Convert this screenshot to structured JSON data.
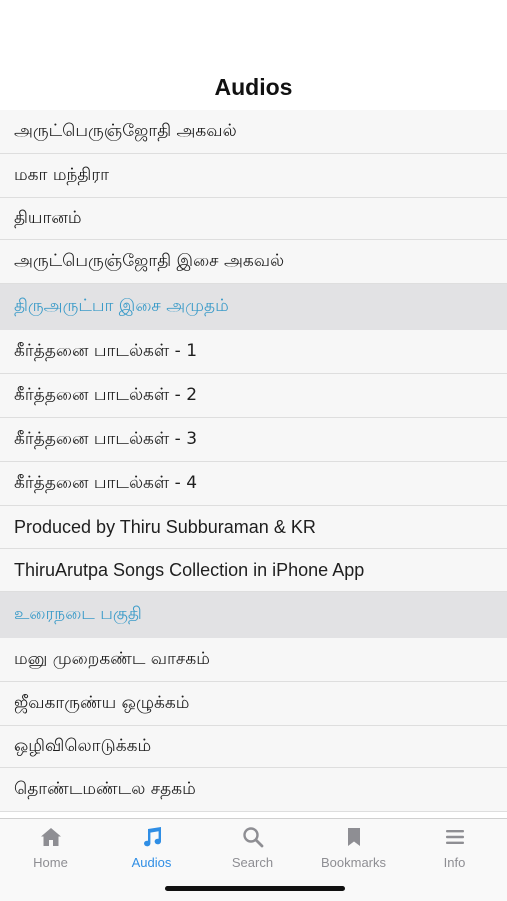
{
  "nav": {
    "title": "Audios"
  },
  "list": {
    "rows": [
      {
        "text": "அருட்பெருஞ்ஜோதி அகவல்",
        "kind": "item"
      },
      {
        "text": "மகா மந்திரா",
        "kind": "item"
      },
      {
        "text": "தியானம்",
        "kind": "item"
      },
      {
        "text": "அருட்பெருஞ்ஜோதி இசை அகவல்",
        "kind": "item"
      },
      {
        "text": "திருஅருட்பா இசை அமுதம்",
        "kind": "header"
      },
      {
        "text": "கீர்த்தனை பாடல்கள் - 1",
        "kind": "item"
      },
      {
        "text": "கீர்த்தனை பாடல்கள் - 2",
        "kind": "item"
      },
      {
        "text": "கீர்த்தனை பாடல்கள் - 3",
        "kind": "item"
      },
      {
        "text": "கீர்த்தனை பாடல்கள் - 4",
        "kind": "item"
      },
      {
        "text": "Produced by Thiru Subburaman & KR",
        "kind": "item"
      },
      {
        "text": "ThiruArutpa Songs Collection in iPhone App",
        "kind": "item"
      },
      {
        "text": "உரைநடை பகுதி",
        "kind": "header"
      },
      {
        "text": "மனு முறைகண்ட வாசகம்",
        "kind": "item"
      },
      {
        "text": "ஜீவகாருண்ய ஒழுக்கம்",
        "kind": "item"
      },
      {
        "text": "ஒழிவிலொடுக்கம்",
        "kind": "item"
      },
      {
        "text": "தொண்டமண்டல சதகம்",
        "kind": "item"
      }
    ]
  },
  "tabbar": {
    "tabs": [
      {
        "label": "Home",
        "icon": "home-icon",
        "active": false
      },
      {
        "label": "Audios",
        "icon": "music-note-icon",
        "active": true
      },
      {
        "label": "Search",
        "icon": "search-icon",
        "active": false
      },
      {
        "label": "Bookmarks",
        "icon": "bookmark-icon",
        "active": false
      },
      {
        "label": "Info",
        "icon": "menu-lines-icon",
        "active": false
      }
    ]
  },
  "colors": {
    "accent": "#2f8ee5",
    "section_header_text": "#3d9cc9",
    "section_header_bg": "#e2e2e4",
    "item_bg": "#f7f7f7",
    "inactive_tab": "#8e8e93"
  }
}
